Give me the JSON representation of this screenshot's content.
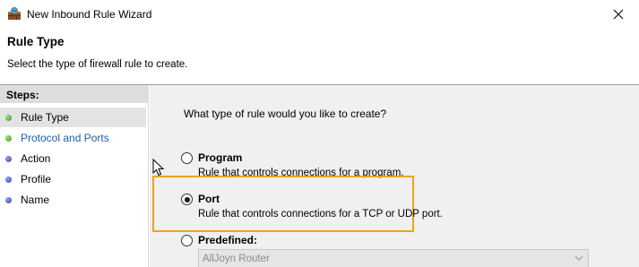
{
  "window": {
    "title": "New Inbound Rule Wizard",
    "icon": "firewall-wizard-icon",
    "close_icon": "close-icon"
  },
  "header": {
    "title": "Rule Type",
    "subtitle": "Select the type of firewall rule to create."
  },
  "steps": {
    "heading": "Steps:",
    "items": [
      {
        "label": "Rule Type",
        "state": "current"
      },
      {
        "label": "Protocol and Ports",
        "state": "link"
      },
      {
        "label": "Action",
        "state": "pending"
      },
      {
        "label": "Profile",
        "state": "pending"
      },
      {
        "label": "Name",
        "state": "pending"
      }
    ]
  },
  "main": {
    "question": "What type of rule would you like to create?",
    "options": [
      {
        "label": "Program",
        "description": "Rule that controls connections for a program.",
        "selected": false
      },
      {
        "label": "Port",
        "description": "Rule that controls connections for a TCP or UDP port.",
        "selected": true
      },
      {
        "label": "Predefined:",
        "description": "",
        "selected": false
      }
    ],
    "predefined_dropdown": {
      "value": "AllJoyn Router",
      "disabled": true
    }
  },
  "colors": {
    "highlight": "#f0a21b",
    "link": "#1f5fa8",
    "step_dot_done": "#2f9a1c",
    "step_dot_pending": "#2b39b8",
    "content_bg": "#f0f0f0"
  }
}
